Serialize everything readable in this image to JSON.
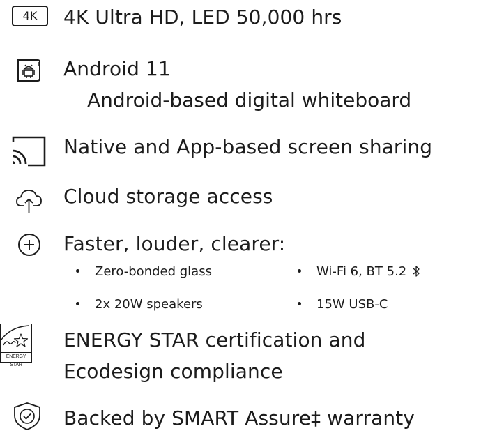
{
  "features": {
    "uhd": {
      "icon": "4k-badge-icon",
      "badge": "4K",
      "label": "4K Ultra HD, LED 50,000 hrs"
    },
    "android": {
      "icon": "android-device-icon",
      "label": "Android 11",
      "sublabel": "Android-based digital whiteboard"
    },
    "screen_sharing": {
      "icon": "cast-icon",
      "label": "Native and App-based screen sharing"
    },
    "cloud": {
      "icon": "cloud-upload-icon",
      "label": "Cloud storage access"
    },
    "performance": {
      "icon": "plus-circle-icon",
      "label": "Faster, louder, clearer:",
      "bullets": [
        "Zero-bonded glass",
        "Wi-Fi 6, BT 5.2",
        "2x 20W speakers",
        "15W USB-C"
      ],
      "bluetooth_icon": "bluetooth-icon"
    },
    "energy": {
      "icon": "energy-star-logo",
      "logo_text": "ENERGY STAR",
      "line1": "ENERGY STAR certification and",
      "line2": "Ecodesign compliance"
    },
    "warranty": {
      "icon": "shield-check-icon",
      "label": "Backed by SMART Assure‡ warranty"
    }
  }
}
